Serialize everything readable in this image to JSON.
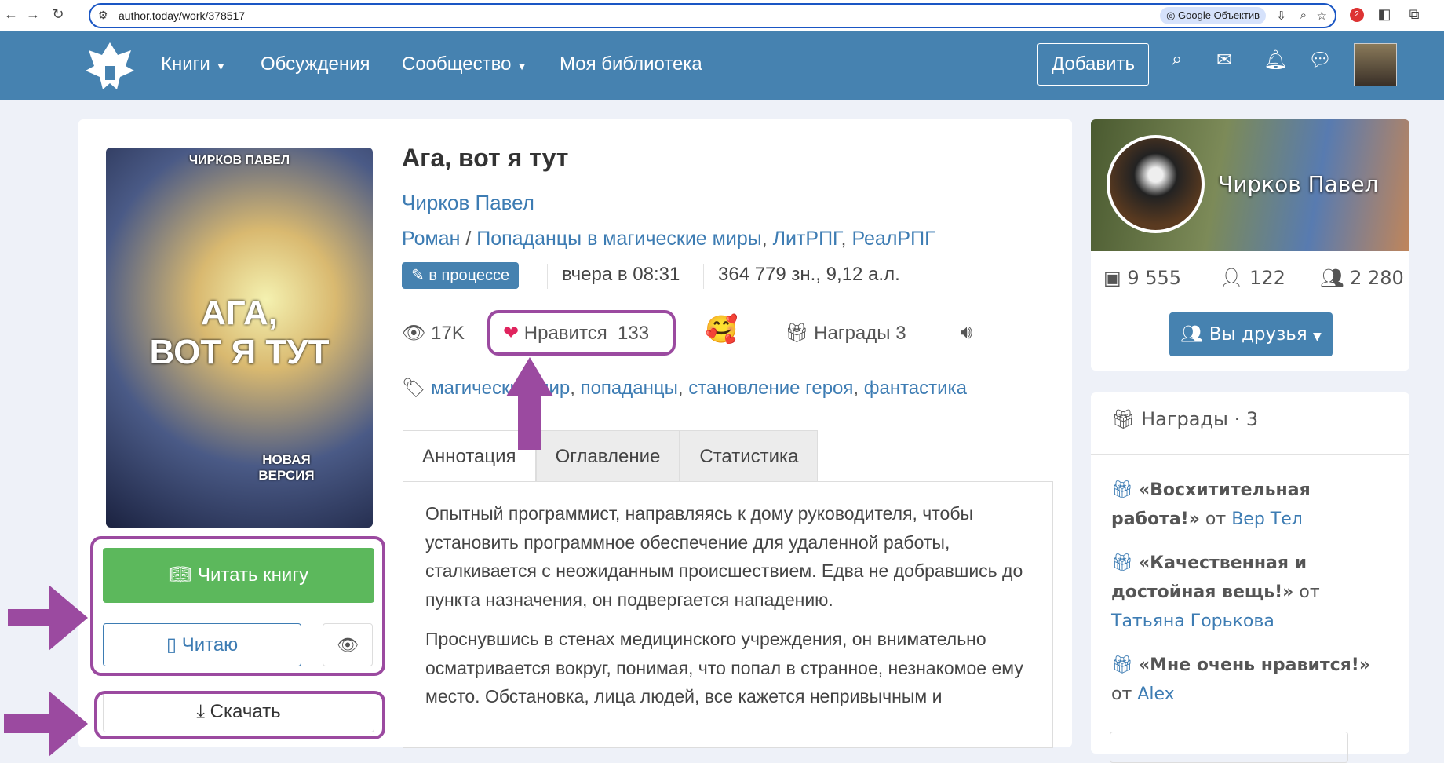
{
  "browser": {
    "url": "author.today/work/378517",
    "lens_label": "Google Объектив",
    "ext_badge": "2"
  },
  "nav": {
    "items": [
      "Книги",
      "Обсуждения",
      "Сообщество",
      "Моя библиотека"
    ],
    "add_label": "Добавить"
  },
  "book": {
    "title": "Ага, вот я тут",
    "author": "Чирков Павел",
    "form": "Роман",
    "genres": [
      "Попаданцы в магические миры",
      "ЛитРПГ",
      "РеалРПГ"
    ],
    "status": "в процессе",
    "updated": "вчера в 08:31",
    "size": "364 779 зн., 9,12 а.л.",
    "views": "17K",
    "likes_label": "Нравится",
    "likes": "133",
    "awards_label": "Награды 3",
    "tags": [
      "магический мир",
      "попаданцы",
      "становление героя",
      "фантастика"
    ],
    "cover": {
      "author": "ЧИРКОВ ПАВЕЛ",
      "title_line1": "АГА,",
      "title_line2": "ВОТ Я ТУТ",
      "badge_line1": "НОВАЯ",
      "badge_line2": "ВЕРСИЯ"
    }
  },
  "tabs": [
    "Аннотация",
    "Оглавление",
    "Статистика"
  ],
  "annotation": [
    "Опытный программист, направляясь к дому руководителя, чтобы установить программное обеспечение для удаленной работы, сталкивается с неожиданным происшествием. Едва не добравшись до пункта назначения, он подвергается нападению.",
    "Проснувшись в стенах медицинского учреждения, он внимательно осматривается вокруг, понимая, что попал в странное, незнакомое ему место. Обстановка, лица людей, все кажется непривычным и"
  ],
  "actions": {
    "read": "Читать книгу",
    "reading": "Читаю",
    "download": "Скачать"
  },
  "profile": {
    "name": "Чирков Павел",
    "books": "9 555",
    "followers": "122",
    "friends": "2 280",
    "friends_button": "Вы друзья"
  },
  "awards": {
    "title": "Награды",
    "count": "3",
    "by": "от",
    "items": [
      {
        "name": "«Восхитительная работа!»",
        "from": "Вер Тел"
      },
      {
        "name": "«Качественная и достойная вещь!»",
        "from": "Татьяна Горькова"
      },
      {
        "name": "«Мне очень нравится!»",
        "from": "Alex"
      }
    ]
  },
  "colors": {
    "nav": "#4682b0",
    "link": "#3d7cb3",
    "read_button": "#5cb85c",
    "annotation": "#9b4aa0"
  }
}
